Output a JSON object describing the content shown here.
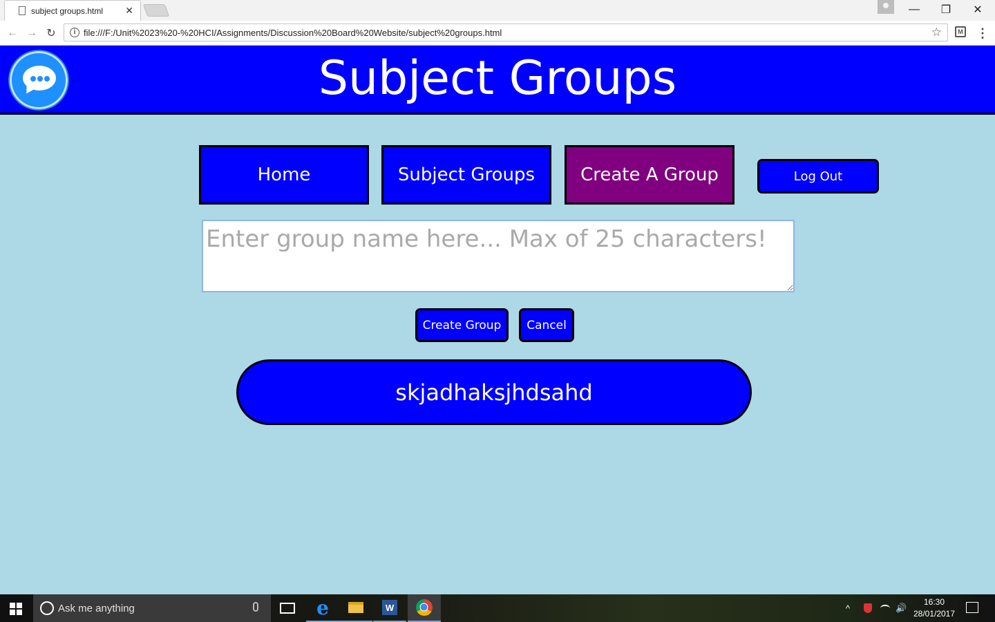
{
  "browser": {
    "tab_title": "subject groups.html",
    "tab_close": "✕",
    "url": "file:///F:/Unit%2023%20-%20HCI/Assignments/Discussion%20Board%20Website/subject%20groups.html",
    "window_buttons": {
      "minimize": "—",
      "maximize": "❐",
      "close": "✕"
    },
    "nav": {
      "back": "←",
      "forward": "→",
      "reload": "↻"
    },
    "info_glyph": "i",
    "star_glyph": "☆",
    "extension_glyph": "M",
    "menu_glyph": "⋮"
  },
  "header": {
    "title": "Subject Groups",
    "logo_icon": "chat-bubble-icon"
  },
  "nav_buttons": {
    "home": "Home",
    "subject_groups": "Subject Groups",
    "create_group": "Create A Group",
    "logout": "Log Out"
  },
  "form": {
    "group_name_value": "",
    "group_name_placeholder": "Enter group name here... Max of 25 characters!",
    "create_label": "Create Group",
    "cancel_label": "Cancel"
  },
  "groups": [
    {
      "name": "skjadhaksjhdsahd"
    }
  ],
  "taskbar": {
    "search_placeholder": "Ask me anything",
    "word_glyph": "W",
    "edge_glyph": "e",
    "clock_time": "16:30",
    "clock_date": "28/01/2017",
    "tray_up": "^",
    "tray_volume": "🔊"
  },
  "colors": {
    "page_background": "#add8e6",
    "header_blue": "#0000ff",
    "active_tab_purple": "#800080",
    "button_blue": "#0000ff"
  }
}
